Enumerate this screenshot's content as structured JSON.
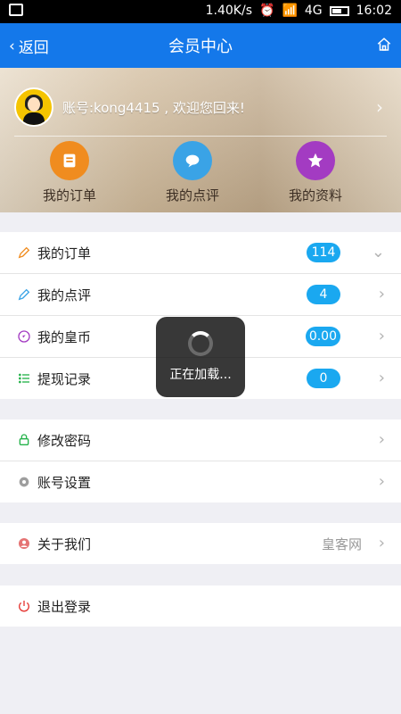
{
  "status_bar": {
    "speed": "1.40K/s",
    "network": "4G",
    "time": "16:02"
  },
  "nav": {
    "back_label": "返回",
    "title": "会员中心"
  },
  "hero": {
    "account_text": "账号:kong4415 , 欢迎您回来!",
    "quick_actions": [
      {
        "label": "我的订单"
      },
      {
        "label": "我的点评"
      },
      {
        "label": "我的资料"
      }
    ]
  },
  "sections": {
    "main": [
      {
        "label": "我的订单",
        "badge": "114"
      },
      {
        "label": "我的点评",
        "badge": "4"
      },
      {
        "label": "我的皇币",
        "badge": "0.00"
      },
      {
        "label": "提现记录",
        "badge": "0"
      }
    ],
    "security": [
      {
        "label": "修改密码"
      },
      {
        "label": "账号设置"
      }
    ],
    "about": [
      {
        "label": "关于我们",
        "right_text": "皇客网"
      }
    ],
    "logout": [
      {
        "label": "退出登录"
      }
    ]
  },
  "toast": {
    "text": "正在加载..."
  },
  "colors": {
    "nav_blue": "#1478ea",
    "badge_blue": "#1aa8f0",
    "orange": "#f08c1f",
    "cyan": "#3aa3e6",
    "purple": "#a33bc2",
    "green": "#24b24a",
    "red": "#e53935"
  }
}
